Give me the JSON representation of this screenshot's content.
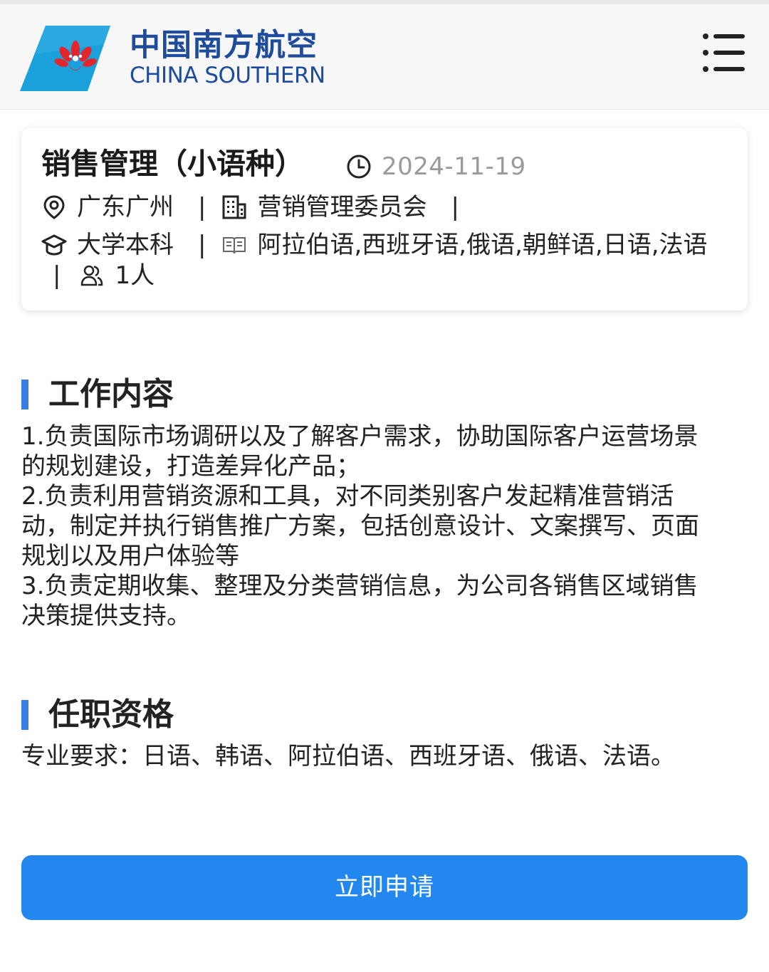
{
  "header": {
    "logo_cn": "中国南方航空",
    "logo_en": "CHINA SOUTHERN",
    "brand_color": "#1e4b9b",
    "logo_bg_color": "#1aa0db",
    "logo_flower_color": "#e4262c",
    "menu_icon": "menu-list-icon"
  },
  "job": {
    "title": "销售管理（小语种）",
    "date": "2024-11-19",
    "location": "广东广州",
    "department": "营销管理委员会",
    "education": "大学本科",
    "majors": "阿拉伯语,西班牙语,俄语,朝鲜语,日语,法语",
    "headcount": "1人",
    "separator": "|",
    "icons": {
      "date": "clock-icon",
      "location": "location-pin-icon",
      "department": "building-icon",
      "education": "graduation-cap-icon",
      "majors": "book-icon",
      "headcount": "people-icon"
    }
  },
  "sections": {
    "duties": {
      "title": "工作内容",
      "lines": [
        "1.负责国际市场调研以及了解客户需求，协助国际客户运营场景",
        "的规划建设，打造差异化产品；",
        "2.负责利用营销资源和工具，对不同类别客户发起精准营销活",
        "动，制定并执行销售推广方案，包括创意设计、文案撰写、页面",
        "规划以及用户体验等",
        "3.负责定期收集、整理及分类营销信息，为公司各销售区域销售",
        "决策提供支持。"
      ]
    },
    "qualifications": {
      "title": "任职资格",
      "lines": [
        "专业要求：日语、韩语、阿拉伯语、西班牙语、俄语、法语。"
      ]
    }
  },
  "apply_button": {
    "label": "立即申请",
    "color": "#2288f0"
  },
  "accent_color": "#3a7de8"
}
